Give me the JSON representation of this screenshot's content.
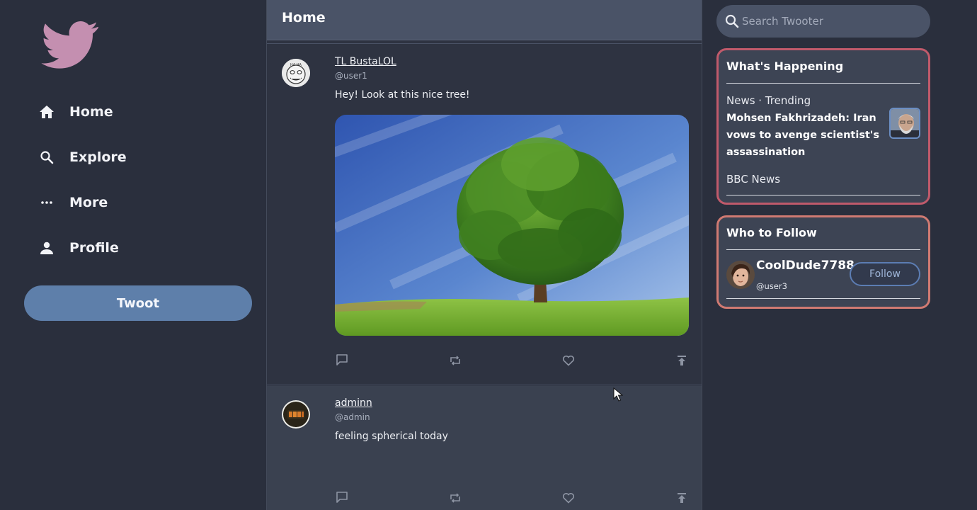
{
  "nav": {
    "items": [
      {
        "label": "Home",
        "icon": "home-icon"
      },
      {
        "label": "Explore",
        "icon": "search-icon"
      },
      {
        "label": "More",
        "icon": "more-icon"
      },
      {
        "label": "Profile",
        "icon": "person-icon"
      }
    ],
    "twoot_label": "Twoot"
  },
  "feed": {
    "title": "Home",
    "posts": [
      {
        "name": "TL BustaLOL",
        "handle": "@user1",
        "text": "Hey! Look at this nice tree!",
        "image": "tree-photo"
      },
      {
        "name": "adminn",
        "handle": "@admin",
        "text": "feeling spherical today"
      }
    ]
  },
  "search": {
    "placeholder": "Search Twooter"
  },
  "happening": {
    "title": "What's Happening",
    "meta": "News · Trending",
    "headline": "Mohsen Fakhrizadeh: Iran vows to avenge scientist's assassination",
    "source": "BBC News"
  },
  "who_to_follow": {
    "title": "Who to Follow",
    "user": {
      "name": "CoolDude7788",
      "handle": "@user3"
    },
    "button_label": "Follow"
  },
  "colors": {
    "background": "#2a2f3d",
    "accent": "#5e7faa",
    "logo": "#c48fb0",
    "card_border_happening": "#c05a6b",
    "card_border_follow": "#d07a72"
  }
}
